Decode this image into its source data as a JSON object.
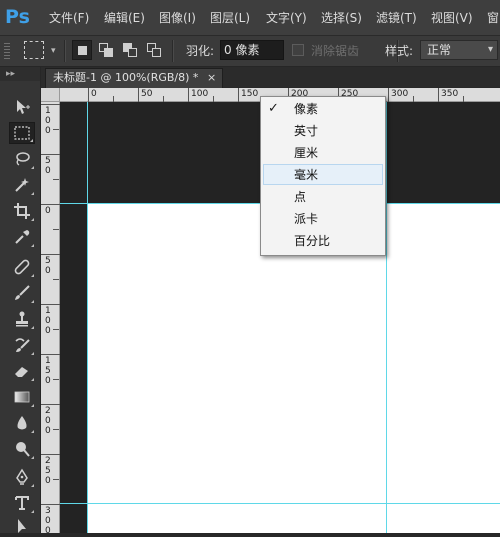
{
  "app": {
    "logo": "Ps"
  },
  "menubar": [
    {
      "label": "文件(F)"
    },
    {
      "label": "编辑(E)"
    },
    {
      "label": "图像(I)"
    },
    {
      "label": "图层(L)"
    },
    {
      "label": "文字(Y)"
    },
    {
      "label": "选择(S)"
    },
    {
      "label": "滤镜(T)"
    },
    {
      "label": "视图(V)"
    },
    {
      "label": "窗"
    }
  ],
  "options": {
    "feather_label": "羽化:",
    "feather_value": "0 像素",
    "antialias_label": "消除锯齿",
    "style_label": "样式:",
    "style_value": "正常",
    "chevron": "▾"
  },
  "document": {
    "tab_title": "未标题-1 @ 100%(RGB/8) *",
    "close": "×"
  },
  "ruler": {
    "h_labels": [
      "0",
      "50",
      "100",
      "150",
      "200",
      "250",
      "300",
      "350"
    ],
    "v_labels": [
      [
        "1",
        "0",
        "0"
      ],
      [
        "5",
        "0"
      ],
      [
        "0"
      ],
      [
        "5",
        "0"
      ],
      [
        "1",
        "0",
        "0"
      ],
      [
        "1",
        "5",
        "0"
      ],
      [
        "2",
        "0",
        "0"
      ],
      [
        "2",
        "5",
        "0"
      ],
      [
        "3",
        "0",
        "0"
      ]
    ]
  },
  "unit_menu": {
    "checkmark": "✓",
    "items": [
      {
        "label": "像素",
        "checked": true
      },
      {
        "label": "英寸"
      },
      {
        "label": "厘米"
      },
      {
        "label": "毫米",
        "hover": true
      },
      {
        "label": "点"
      },
      {
        "label": "派卡"
      },
      {
        "label": "百分比"
      }
    ]
  },
  "tools": [
    {
      "icon": "move-tool-icon"
    },
    {
      "icon": "rectangular-marquee-icon",
      "active": true
    },
    {
      "icon": "lasso-icon"
    },
    {
      "icon": "magic-wand-icon"
    },
    {
      "icon": "crop-icon"
    },
    {
      "icon": "eyedropper-icon"
    },
    {
      "icon": "healing-brush-icon"
    },
    {
      "icon": "brush-icon"
    },
    {
      "icon": "clone-stamp-icon"
    },
    {
      "icon": "history-brush-icon"
    },
    {
      "icon": "eraser-icon"
    },
    {
      "icon": "gradient-icon"
    },
    {
      "icon": "blur-icon"
    },
    {
      "icon": "dodge-icon"
    },
    {
      "icon": "pen-icon"
    },
    {
      "icon": "type-icon"
    },
    {
      "icon": "path-selection-icon"
    }
  ]
}
